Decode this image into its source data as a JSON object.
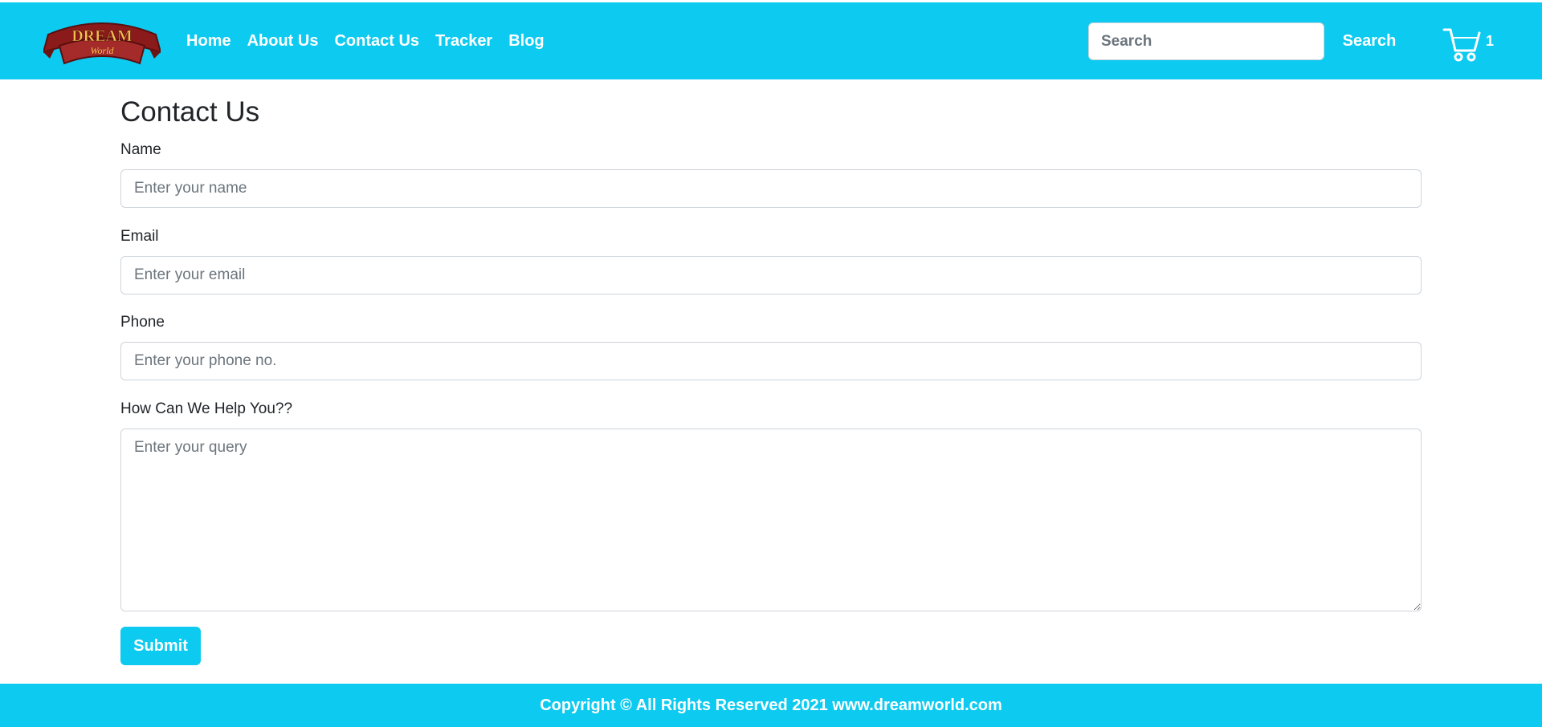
{
  "brand": {
    "logo_top": "DREAM",
    "logo_bottom": "World",
    "colors": {
      "primary": "#0dcaf0",
      "logo_red": "#8b1a1a",
      "logo_gold": "#f2c14e"
    }
  },
  "nav": {
    "links": [
      "Home",
      "About Us",
      "Contact Us",
      "Tracker",
      "Blog"
    ]
  },
  "search": {
    "placeholder": "Search",
    "button_label": "Search"
  },
  "cart": {
    "icon": "cart-icon",
    "count": "1"
  },
  "form": {
    "title": "Contact Us",
    "name_label": "Name",
    "name_placeholder": "Enter your name",
    "email_label": "Email",
    "email_placeholder": "Enter your email",
    "phone_label": "Phone",
    "phone_placeholder": "Enter your phone no.",
    "query_label": "How Can We Help You??",
    "query_placeholder": "Enter your query",
    "submit_label": "Submit"
  },
  "footer": {
    "text": "Copyright © All Rights Reserved 2021 www.dreamworld.com"
  }
}
